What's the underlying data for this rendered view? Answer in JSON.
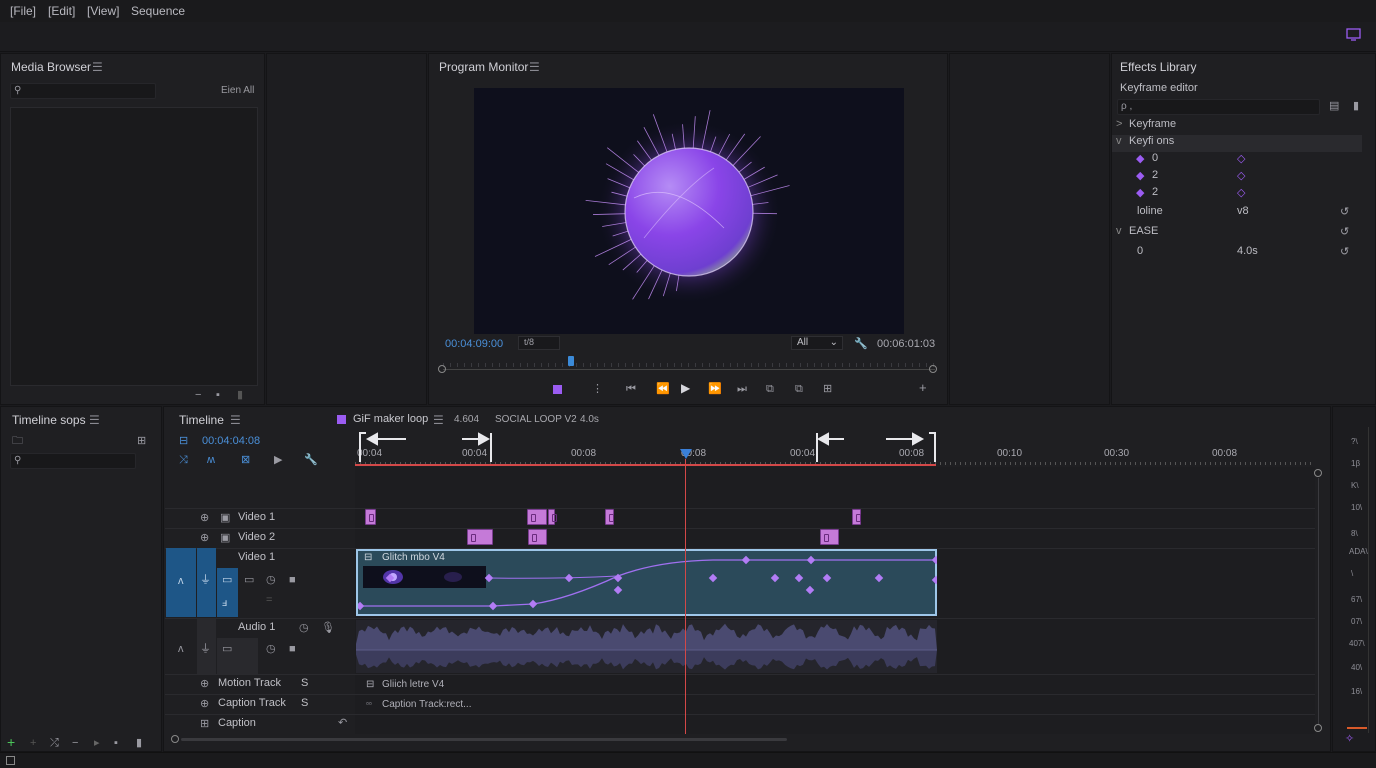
{
  "menu": [
    "[File]",
    "[Edit]",
    "[View]",
    "Sequence"
  ],
  "media_browser": {
    "title": "Media Browser",
    "search_placeholder": "",
    "filter_label": "Eien All"
  },
  "program_monitor": {
    "title": "Program Monitor",
    "current_time": "00:04:09:00",
    "fps_label": "t/8",
    "zoom_select": "All",
    "duration": "00:06:01:03",
    "playhead_fraction": 0.26
  },
  "effects_library": {
    "title": "Effects Library",
    "subtitle": "Keyframe editor",
    "search_placeholder": "ρ ,",
    "rows": [
      {
        "label": "Keyframe",
        "expand": ">",
        "value": ""
      },
      {
        "label": "Keyfi ons",
        "expand": "v",
        "value": ""
      },
      {
        "label": "0",
        "diamond": true,
        "value": ""
      },
      {
        "label": "2",
        "diamond": true,
        "value": ""
      },
      {
        "label": "2",
        "diamond": true,
        "value": ""
      },
      {
        "label": "loline",
        "value": "v8",
        "reset": true
      },
      {
        "label": "EASE",
        "expand": "v",
        "value": "",
        "reset": true
      },
      {
        "label": "0",
        "value": "4.0s",
        "reset": true
      }
    ]
  },
  "timeline_sops": {
    "title": "Timeline sops"
  },
  "timeline": {
    "title": "Timeline",
    "tab_name": "GiF maker loop",
    "tab_code": "4.604",
    "sequence": "SOCIAL LOOP V2",
    "sequence_dur": "4.0s",
    "timecode": "00:04:04:08",
    "ruler": [
      "00:04",
      "00:04",
      "00:08",
      "00:08",
      "00:04",
      "00:08",
      "00:10",
      "00:30",
      "00:08"
    ],
    "tracks": [
      {
        "name": "Video 1"
      },
      {
        "name": "Video 2"
      },
      {
        "name": "Video 1"
      },
      {
        "name": "Audio 1"
      },
      {
        "name": "Motion Track",
        "flag": "S"
      },
      {
        "name": "Caption Track",
        "flag": "S"
      },
      {
        "name": "Caption"
      }
    ],
    "main_clip": "Glitch mbo V4",
    "motion_clip": "Gliich letre V4",
    "caption_clip": "Caption Track:rect...",
    "playhead_fraction": 0.345
  },
  "meter_labels": [
    "?\\",
    "1β",
    "K\\",
    "10\\",
    "8\\",
    "ADA\\",
    "\\",
    "67\\",
    "07\\",
    "407\\",
    "40\\",
    "16\\"
  ],
  "colors": {
    "accent": "#9b5cf2",
    "timecode": "#4a8fd8",
    "clip": "#2b4a5a",
    "playhead": "#d34848",
    "clip_border": "#9ec6e8"
  }
}
